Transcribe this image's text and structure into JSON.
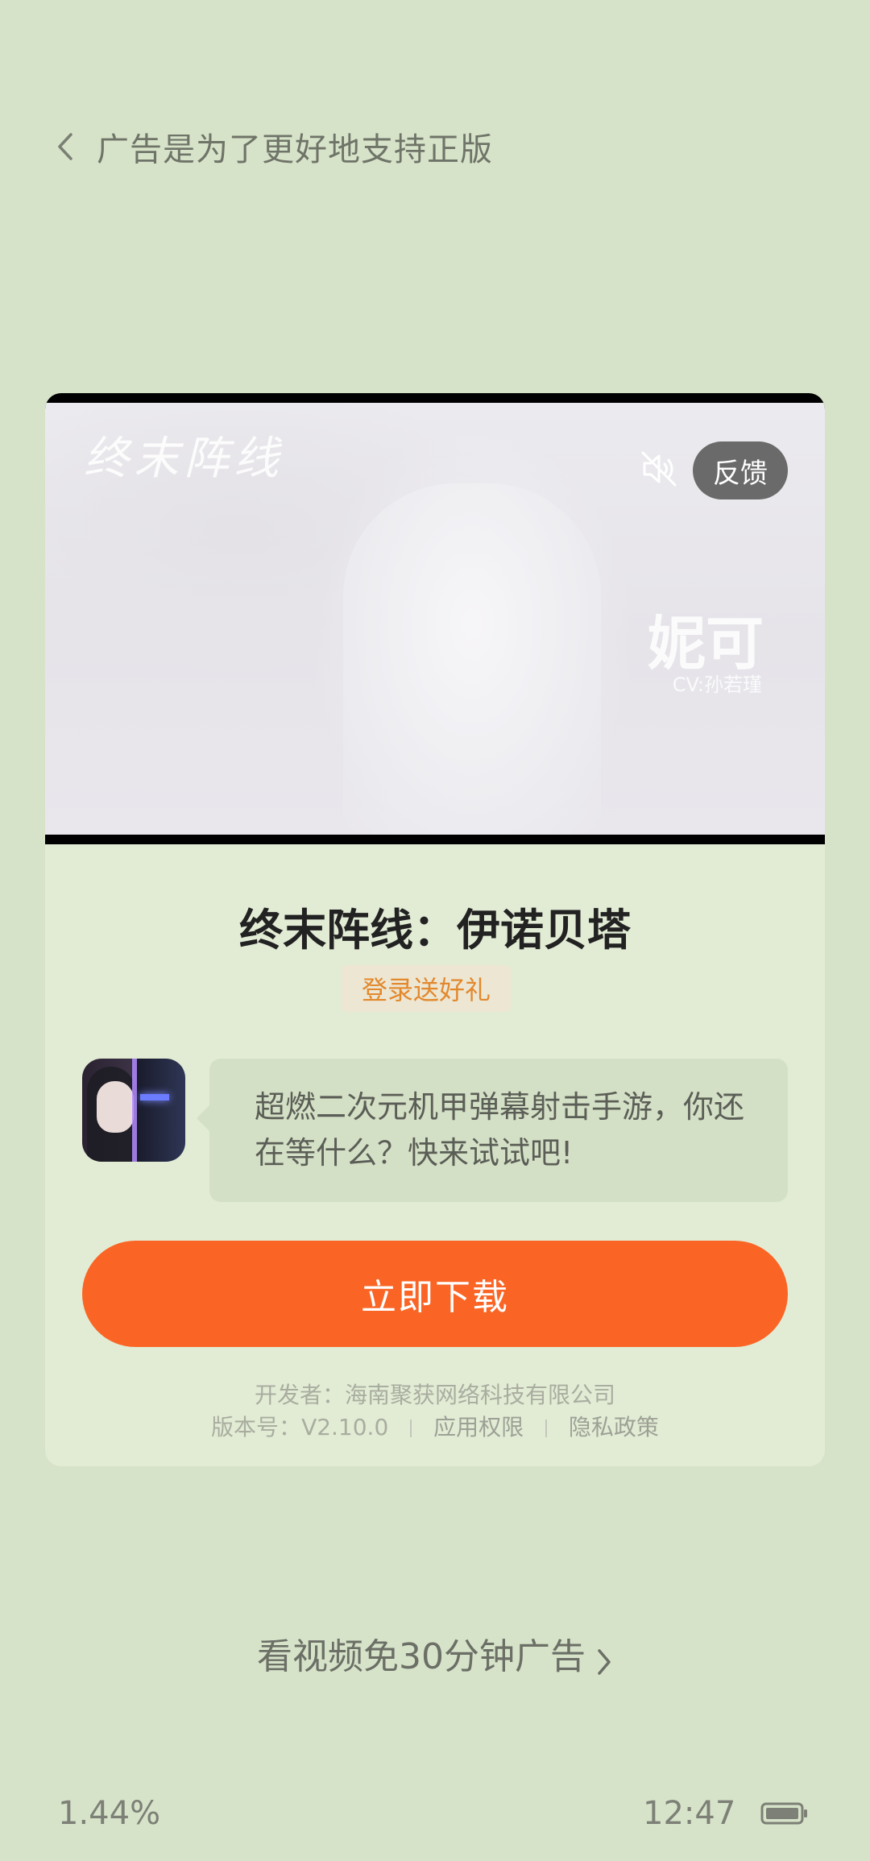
{
  "header": {
    "title": "广告是为了更好地支持正版"
  },
  "ad": {
    "video": {
      "logo_text": "终末阵线",
      "caption_name": "妮可",
      "caption_cv": "CV:孙若瑾",
      "feedback_label": "反馈",
      "muted": true
    },
    "app_name": "终末阵线：伊诺贝塔",
    "promo_badge": "登录送好礼",
    "description": "超燃二次元机甲弹幕射击手游，你还在等什么？快来试试吧!",
    "download_label": "立即下载",
    "developer_label": "开发者：",
    "developer": "海南聚获网络科技有限公司",
    "version_label": "版本号：",
    "version": "V2.10.0",
    "permissions_link": "应用权限",
    "privacy_link": "隐私政策"
  },
  "watch_video_label": "看视频免30分钟广告",
  "status_bar": {
    "left_text": "1.44%",
    "time": "12:47"
  },
  "colors": {
    "background": "#d7e3c9",
    "card": "#e2ecd5",
    "download_button": "#fa6525",
    "promo_text": "#e2892e"
  },
  "icons": {
    "back": "chevron-left-icon",
    "mute": "volume-mute-icon",
    "watch_chevron": "chevron-right-icon",
    "battery": "battery-icon"
  }
}
